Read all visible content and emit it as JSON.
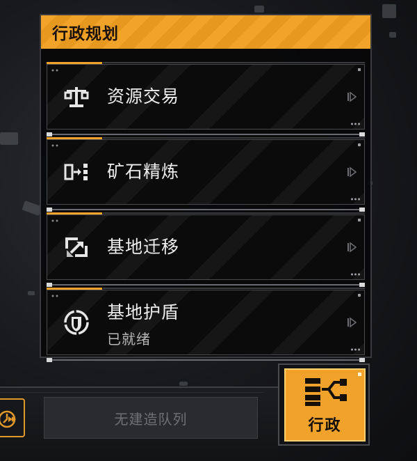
{
  "panel": {
    "title": "行政规划",
    "items": [
      {
        "label": "资源交易",
        "sublabel": "",
        "icon": "balance-scale-icon"
      },
      {
        "label": "矿石精炼",
        "sublabel": "",
        "icon": "refine-flow-icon"
      },
      {
        "label": "基地迁移",
        "sublabel": "",
        "icon": "relocate-arrow-icon"
      },
      {
        "label": "基地护盾",
        "sublabel": "已就绪",
        "icon": "shield-icon"
      }
    ]
  },
  "bottom": {
    "queue_text": "无建造队列",
    "admin_label": "行政",
    "speed_icon": "speed-up-icon",
    "admin_icon": "admin-network-icon"
  },
  "colors": {
    "accent": "#f0a22b",
    "panel_bg": "#0b0b0c",
    "text": "#ededed"
  }
}
